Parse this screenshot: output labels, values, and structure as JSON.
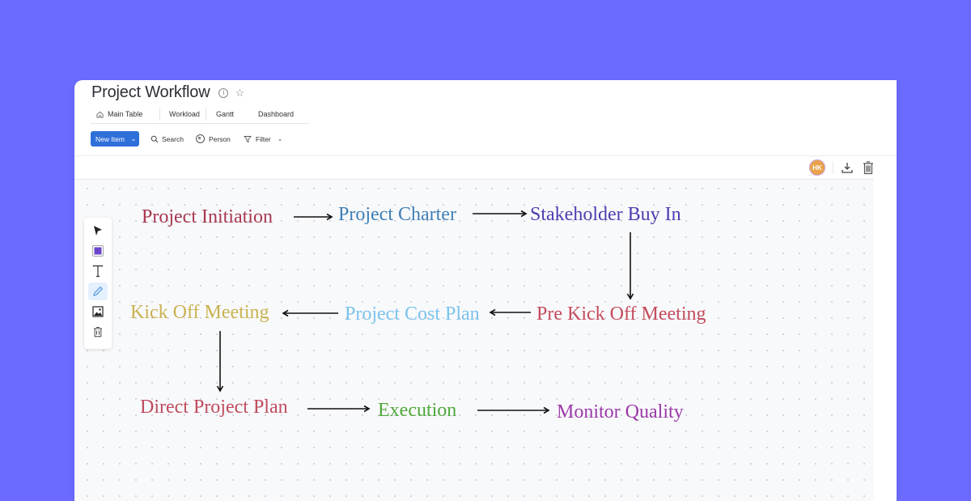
{
  "board": {
    "title": "Project Workflow",
    "info_icon": "info-icon",
    "star_icon": "star-icon"
  },
  "tabs": [
    {
      "label": "Main Table",
      "icon": "home-icon"
    },
    {
      "label": "Workload"
    },
    {
      "label": "Gantt"
    },
    {
      "label": "Dashboard"
    }
  ],
  "toolbar": {
    "new_item_label": "New Item",
    "search_label": "Search",
    "person_label": "Person",
    "filter_label": "Filter"
  },
  "whiteboard_bar": {
    "avatar_initials": "HK",
    "avatar_color": "#e8a24a"
  },
  "side_tools": [
    {
      "name": "select",
      "icon": "cursor-arrow-icon"
    },
    {
      "name": "color",
      "icon": "color-swatch-icon",
      "color": "#6b45c9"
    },
    {
      "name": "text",
      "icon": "text-icon"
    },
    {
      "name": "pen",
      "icon": "pencil-icon",
      "active": true
    },
    {
      "name": "image",
      "icon": "image-icon"
    },
    {
      "name": "delete",
      "icon": "trash-icon"
    }
  ],
  "workflow": {
    "nodes": [
      {
        "id": "initiation",
        "label": "Project Initiation",
        "color": "#a8384f"
      },
      {
        "id": "charter",
        "label": "Project Charter",
        "color": "#3f7fb5"
      },
      {
        "id": "buyin",
        "label": "Stakeholder Buy In",
        "color": "#4a3fb0"
      },
      {
        "id": "prekickoff",
        "label": "Pre Kick Off Meeting",
        "color": "#c44b5c"
      },
      {
        "id": "costplan",
        "label": "Project Cost Plan",
        "color": "#7cc3ec"
      },
      {
        "id": "kickoff",
        "label": "Kick Off Meeting",
        "color": "#c9b250"
      },
      {
        "id": "directplan",
        "label": "Direct Project Plan",
        "color": "#c04b5e"
      },
      {
        "id": "execution",
        "label": "Execution",
        "color": "#4fa83a"
      },
      {
        "id": "monitor",
        "label": "Monitor Quality",
        "color": "#9b3aa8"
      }
    ],
    "edges": [
      {
        "from": "initiation",
        "to": "charter"
      },
      {
        "from": "charter",
        "to": "buyin"
      },
      {
        "from": "buyin",
        "to": "prekickoff"
      },
      {
        "from": "prekickoff",
        "to": "costplan"
      },
      {
        "from": "costplan",
        "to": "kickoff"
      },
      {
        "from": "kickoff",
        "to": "directplan"
      },
      {
        "from": "directplan",
        "to": "execution"
      },
      {
        "from": "execution",
        "to": "monitor"
      }
    ]
  }
}
